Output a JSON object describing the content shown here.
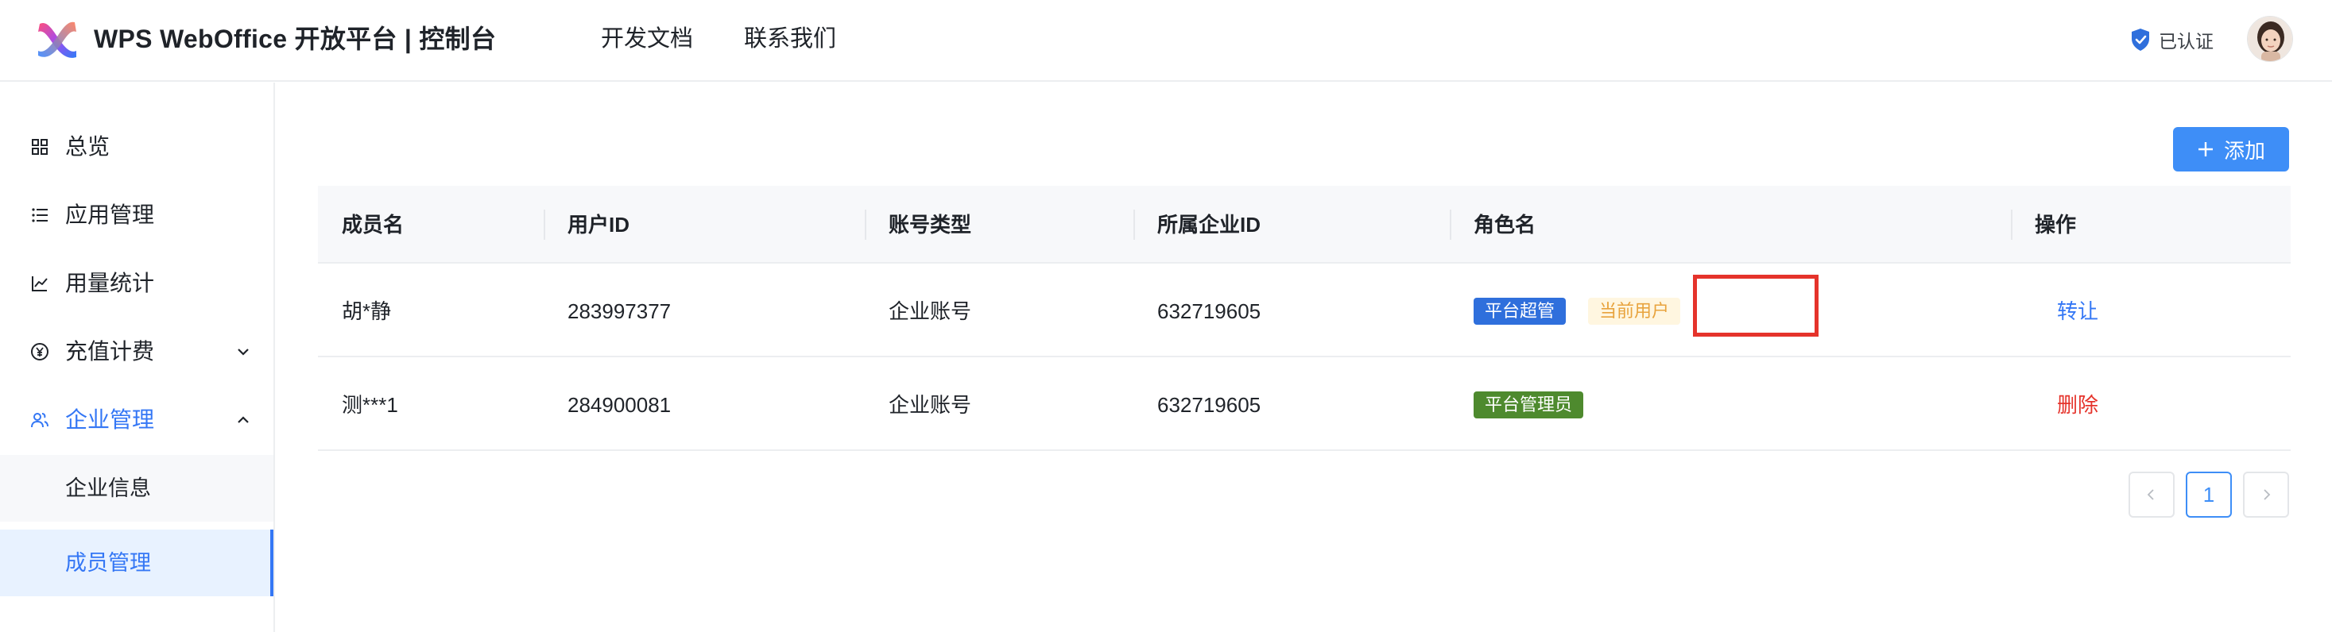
{
  "header": {
    "brand": "WPS WebOffice 开放平台 | 控制台",
    "nav": [
      "开发文档",
      "联系我们"
    ],
    "verified_label": "已认证"
  },
  "sidebar": {
    "items": [
      {
        "label": "总览",
        "icon": "grid-icon"
      },
      {
        "label": "应用管理",
        "icon": "list-icon"
      },
      {
        "label": "用量统计",
        "icon": "line-chart-icon"
      },
      {
        "label": "充值计费",
        "icon": "yen-icon"
      },
      {
        "label": "企业管理",
        "icon": "users-icon"
      }
    ],
    "sub_items": [
      {
        "label": "企业信息"
      },
      {
        "label": "成员管理"
      }
    ]
  },
  "toolbar": {
    "add_label": "添加"
  },
  "table": {
    "columns": [
      "成员名",
      "用户ID",
      "账号类型",
      "所属企业ID",
      "角色名",
      "操作"
    ],
    "rows": [
      {
        "name": "胡*静",
        "user_id": "283997377",
        "account_type": "企业账号",
        "company_id": "632719605",
        "role": "平台超管",
        "extra_tag": "当前用户",
        "action": "转让"
      },
      {
        "name": "测***1",
        "user_id": "284900081",
        "account_type": "企业账号",
        "company_id": "632719605",
        "role": "平台管理员",
        "action": "删除"
      }
    ]
  },
  "pagination": {
    "current_page": "1"
  },
  "colors": {
    "accent": "#3e8ef7",
    "link": "#3477f5",
    "danger": "#e5332b",
    "tag_super": "#2f6fdc",
    "tag_admin": "#4e8a2e",
    "tag_current_text": "#e8a33d"
  }
}
